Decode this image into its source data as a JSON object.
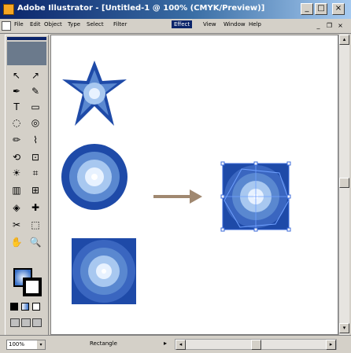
{
  "window": {
    "title": "Adobe Illustrator - [Untitled-1 @ 100% (CMYK/Preview)]",
    "buttons": {
      "minimize": "_",
      "maximize": "□",
      "close": "×"
    }
  },
  "menu": {
    "items": [
      "Edit",
      "Object",
      "Type",
      "Select",
      "Filter",
      "Effect",
      "View",
      "Window",
      "Help"
    ],
    "first": "File",
    "active_index": 5,
    "mdi": {
      "minimize": "_",
      "restore": "❐",
      "close": "×"
    }
  },
  "toolbox": {
    "tools": [
      "↖",
      "↗",
      "✒",
      "✎",
      "T",
      "▭",
      "◌",
      "◎",
      "✏",
      "⌇",
      "⟲",
      "⊡",
      "☀",
      "⌗",
      "▥",
      "⊞",
      "◈",
      "✚",
      "✂",
      "✋",
      "🔍",
      "⬚"
    ]
  },
  "status": {
    "zoom": "100%",
    "zoom_arrow": "▾",
    "tool_label": "Rectangle",
    "scroll_arrows": {
      "up": "▴",
      "down": "▾",
      "left": "◂",
      "right": "▸",
      "mid": "▸"
    }
  },
  "colors": {
    "title_start": "#0a246a",
    "title_end": "#a6caf0",
    "shape_dark": "#1e4aa8",
    "shape_mid": "#5a88d0",
    "shape_light": "#a8c8f0",
    "shape_center": "#e8f2ff",
    "arrow": "#a08870",
    "selection": "#3a6ad8"
  }
}
